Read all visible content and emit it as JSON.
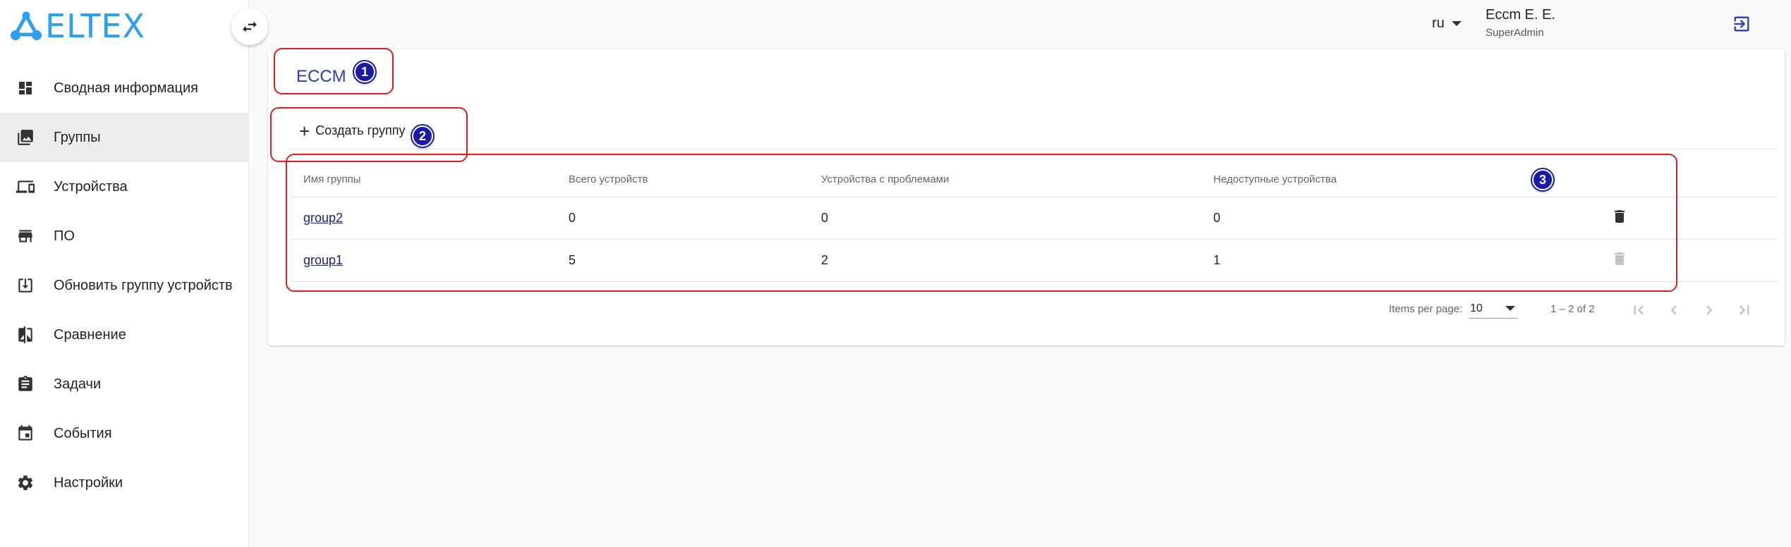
{
  "logo": {
    "text": "ELTEX",
    "color": "#2c9ff0"
  },
  "sidebar": {
    "items": [
      {
        "label": "Сводная информация",
        "icon": "dashboard-icon",
        "active": false
      },
      {
        "label": "Группы",
        "icon": "image-group-icon",
        "active": true
      },
      {
        "label": "Устройства",
        "icon": "devices-icon",
        "active": false
      },
      {
        "label": "ПО",
        "icon": "store-icon",
        "active": false
      },
      {
        "label": "Обновить группу устройств",
        "icon": "download-box-icon",
        "active": false
      },
      {
        "label": "Сравнение",
        "icon": "compare-icon",
        "active": false
      },
      {
        "label": "Задачи",
        "icon": "clipboard-icon",
        "active": false
      },
      {
        "label": "События",
        "icon": "calendar-icon",
        "active": false
      },
      {
        "label": "Настройки",
        "icon": "gear-icon",
        "active": false
      }
    ]
  },
  "header": {
    "lang": "ru",
    "user_name": "Eccm E. E.",
    "user_role": "SuperAdmin"
  },
  "main": {
    "title": "ECCM",
    "create_label": "Создать группу",
    "table": {
      "headers": [
        "Имя группы",
        "Всего устройств",
        "Устройства с проблемами",
        "Недоступные устройства"
      ],
      "rows": [
        {
          "name": "group2",
          "total": "0",
          "problems": "0",
          "unavailable": "0"
        },
        {
          "name": "group1",
          "total": "5",
          "problems": "2",
          "unavailable": "1"
        }
      ]
    },
    "pager": {
      "items_per_page_label": "Items per page:",
      "page_size": "10",
      "range": "1 – 2 of 2"
    }
  },
  "annotations": {
    "badge1": "1",
    "badge2": "2",
    "badge3": "3"
  },
  "colors": {
    "accent": "#2c3ea8",
    "annotation": "#e01b1b",
    "badge": "#1a1aa8"
  }
}
